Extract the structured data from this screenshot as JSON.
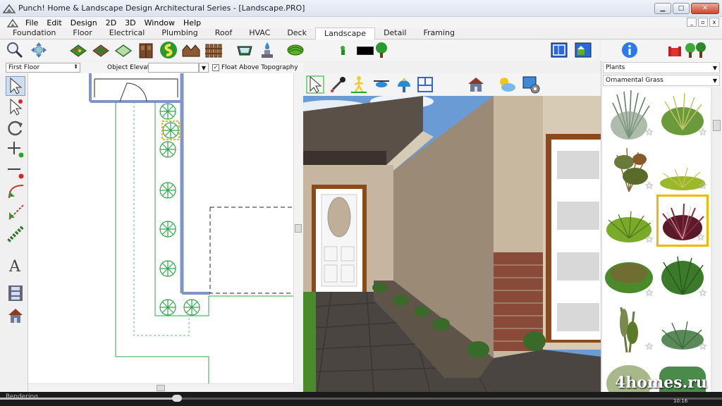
{
  "window": {
    "title": "Punch! Home & Landscape Design Architectural Series - [Landscape.PRO]",
    "minimize_glyph": "▁",
    "maximize_glyph": "□",
    "close_glyph": "✕"
  },
  "menu": {
    "items": [
      "File",
      "Edit",
      "Design",
      "2D",
      "3D",
      "Window",
      "Help"
    ],
    "mdi_buttons": [
      "_",
      "▫",
      "x"
    ]
  },
  "tabs": [
    "Foundation",
    "Floor",
    "Electrical",
    "Plumbing",
    "Roof",
    "HVAC",
    "Deck",
    "Landscape",
    "Detail",
    "Framing"
  ],
  "active_tab": "Landscape",
  "floorbar": {
    "floor": "First Floor",
    "elevation_label": "Object Elevation:",
    "float_label": "Float Above Topography",
    "float_checked": true
  },
  "library": {
    "category": "Plants",
    "subcategory": "Ornamental Grass",
    "selected_index": 5
  },
  "status": {
    "text": "Rendering",
    "time": "10:16",
    "progress": 0.245
  },
  "watermark": "4homes.ru",
  "colors": {
    "accent_selected": "#f2b900",
    "plan_wall": "#7f95c9",
    "plan_green": "#2da84a",
    "sky": "#6b9bd5"
  },
  "icons": {
    "toolbar": [
      "zoom-icon",
      "pan-icon",
      "garden-bed-icon",
      "planter-icon",
      "ground-cover-icon",
      "fence-door-icon",
      "path-icon",
      "shed-icon",
      "fence-icon",
      "pond-icon",
      "fountain-icon",
      "hedge-icon",
      "plant-size-icon",
      "floorplan-icon",
      "elevation-icon",
      "info-icon",
      "furniture-icon"
    ],
    "view": [
      "select-3d-icon",
      "eyedropper-icon",
      "walk-icon",
      "fly-icon",
      "tour-icon",
      "plan-3d-icon",
      "house-exterior-icon",
      "sky-icon",
      "render-settings-icon"
    ],
    "left": [
      "select-icon",
      "multi-select-icon",
      "rotate-icon",
      "add-point-icon",
      "remove-point-icon",
      "curve-icon",
      "arc-icon",
      "chain-icon",
      "text-icon",
      "filmstrip-icon",
      "house-view-icon"
    ]
  }
}
